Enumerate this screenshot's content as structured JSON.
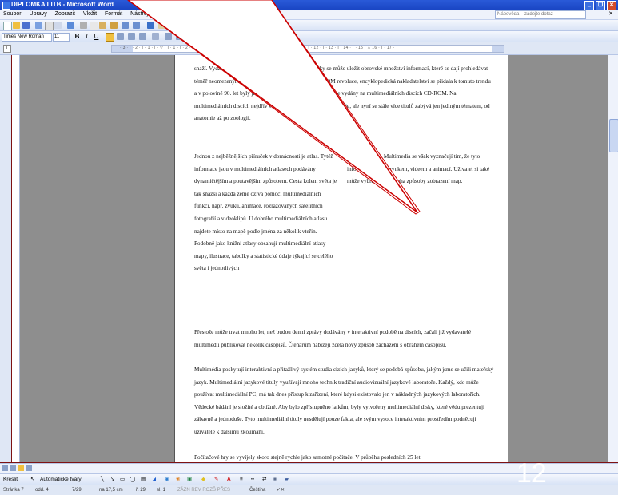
{
  "window": {
    "title": "DIPLOMKA LITB - Microsoft Word"
  },
  "menu": {
    "items": [
      "Soubor",
      "Úpravy",
      "Zobrazit",
      "Vložit",
      "Formát",
      "Nástroje",
      "Tabulka",
      "Okno",
      "Nápověda"
    ],
    "help_placeholder": "Nápověda – zadejte dotaz"
  },
  "toolbar": {
    "font_name": "Times New Roman",
    "font_size": "11",
    "zoom": "100%"
  },
  "document": {
    "p1": "snaží. Vydavatelé si brzy uvědomili, že CD a DVD disky se může uložit obrovské množství informací, které se dají prohledávat téměř neomezeným počtem způsobů. Když nastala CD-ROM revoluce, encyklopedická nakladatelství se přidala k tomuto trendu a v polovině 90. let byly již všechny významnější encyklopedie vydány na multimediálních discích CD-ROM. Na multimediálních discích nejdřív vycházely všeobecné encyklopedie, ale nyní se stále více titulů zabývá jen jediným tématem, od anatomie až po zoologii.",
    "col_left": "Jednou z nejběžnějších příruček v domácnosti je atlas. Tytéž informace jsou v multimediálních atlasech podávány dynamičtějším a poutavějším způsobem. Cesta kolem světa je tak snazší a každá země ožívá pomocí multimediálních funkcí, např. zvuku, animace, rozřazovaných satelitních fotografií a videoklipů. U dobrého multimediálních atlasu najdete místo na mapě podle jména za několik vteřin. Podobně jako knižní atlasy obsahují multimediální atlasy mapy, ilustrace, tabulky a statistické údaje týkající se celého světa i jednotlivých",
    "col_right": "regionů a států. Multimedia se však vyznačují tím, že tyto informace oživují zvukem, videem a animací. Uživatel si také může vybrat mezi mnoha způsoby zobrazení map.",
    "p2": "Přestože může trvat mnoho let, než budou denní zprávy dodávány v interaktivní podobě na discích, začali již vydavatelé multimédií publikovat několik časopisů. Čtenářům nabízejí zcela nový způsob zacházení s obrahem časopisu.",
    "p3": "Multimédia poskytují interaktivní a přitažlivý systém studia cizích jazyků, který se podobá způsobu, jakým jsme se učili mateřský jazyk. Multimediální jazykové tituly využívají mnoho technik tradiční audiovizuální jazykové laboratoře. Každý, kdo může používat multimediální PC, má tak dnes přístup k zařízení, které kdysi existovalo jen v nákladných jazykových laboratořích. Vědecké bádání je složité a obtížné. Aby bylo zpřístupněno laikům, byly vytvořeny multimediální disky, které vědu prezentují zábavně a jednoduše. Tyto multimediální tituly nesdělují pouze fakta, ale svým vysoce interaktivním prostředím podněcují uživatele k dalšímu zkoumání.",
    "p4": "Počítačové hry se vyvíjely skoro stejně rychle jako samotné počítače. V průběhu posledních 25 let"
  },
  "drawbar": {
    "draw": "Kreslit",
    "autoshapes": "Automatické tvary"
  },
  "status": {
    "page": "Stránka 7",
    "section": "odd. 4",
    "pages": "7/29",
    "position": "na 17,5 cm",
    "line": "ř. 29",
    "col": "sl. 1",
    "modes": "ZÁZN  REV  ROZŠ  PŘES",
    "language": "Čeština"
  },
  "slide": {
    "number": "12"
  }
}
